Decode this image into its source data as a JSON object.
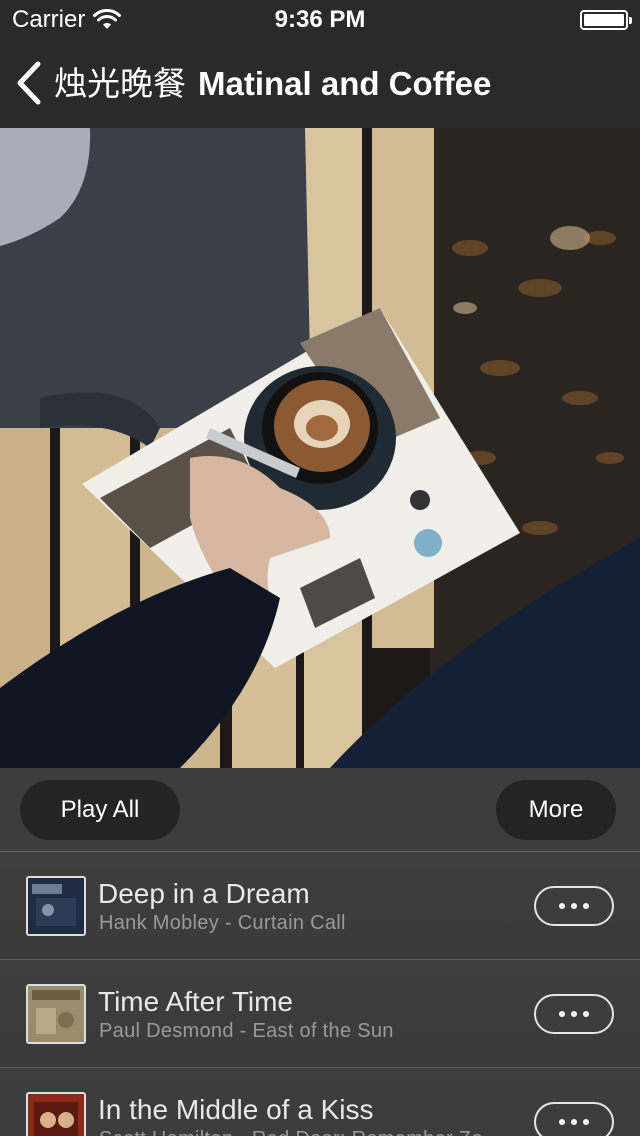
{
  "status_bar": {
    "carrier": "Carrier",
    "time": "9:36 PM",
    "wifi_icon": "wifi-icon",
    "battery_level": 1.0
  },
  "nav": {
    "back_icon": "chevron-left-icon",
    "title_cn": "烛光晚餐",
    "title_en": "Matinal and Coffee"
  },
  "actions": {
    "play_all": "Play All",
    "more": "More"
  },
  "songs": [
    {
      "title": "Deep in a Dream",
      "subtitle": "Hank Mobley - Curtain Call"
    },
    {
      "title": "Time After Time",
      "subtitle": "Paul Desmond - East of the Sun"
    },
    {
      "title": "In the Middle of a Kiss",
      "subtitle": "Scott Hamilton - Red Door: Remember Zo"
    }
  ],
  "colors": {
    "background": "#3a3a3a",
    "nav_background": "#2a2a2a",
    "pill_background": "#242424"
  }
}
